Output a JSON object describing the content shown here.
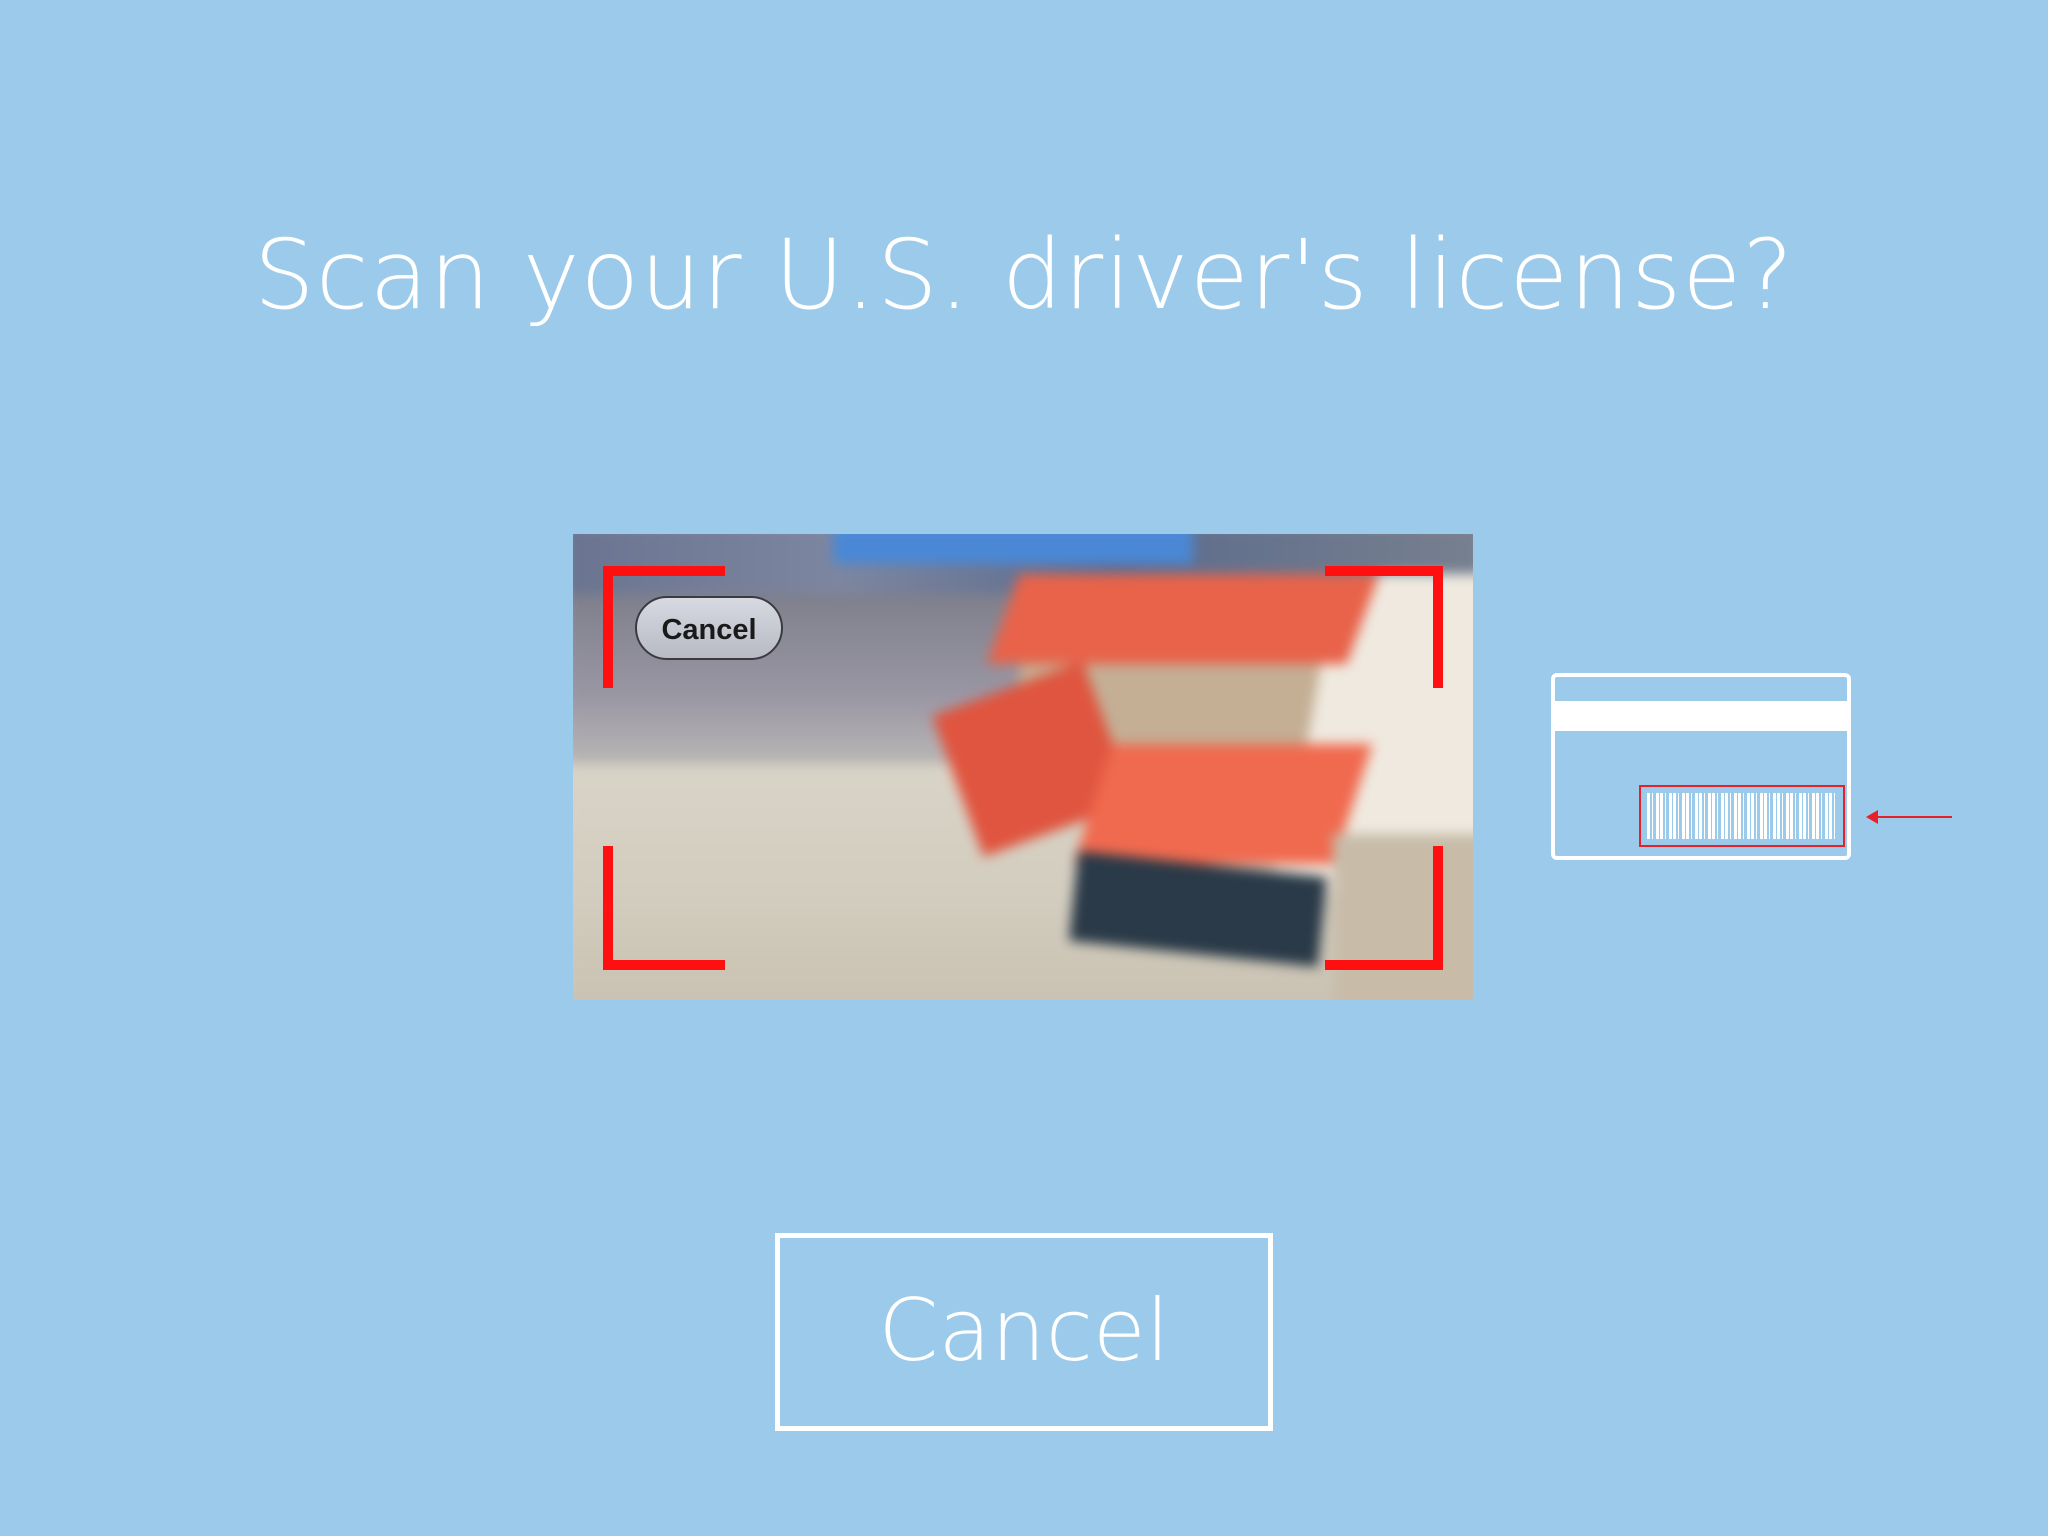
{
  "prompt": {
    "title": "Scan your U.S. driver's license?"
  },
  "camera_preview": {
    "cancel_label": "Cancel"
  },
  "actions": {
    "cancel_label": "Cancel"
  },
  "colors": {
    "background": "#9ccaea",
    "foreground": "#ffffff",
    "scan_bracket": "#ff1010",
    "barcode_highlight": "#e8202a"
  },
  "icons": {
    "license_illustration": "license-back-barcode-icon",
    "pointer": "arrow-left-icon"
  }
}
